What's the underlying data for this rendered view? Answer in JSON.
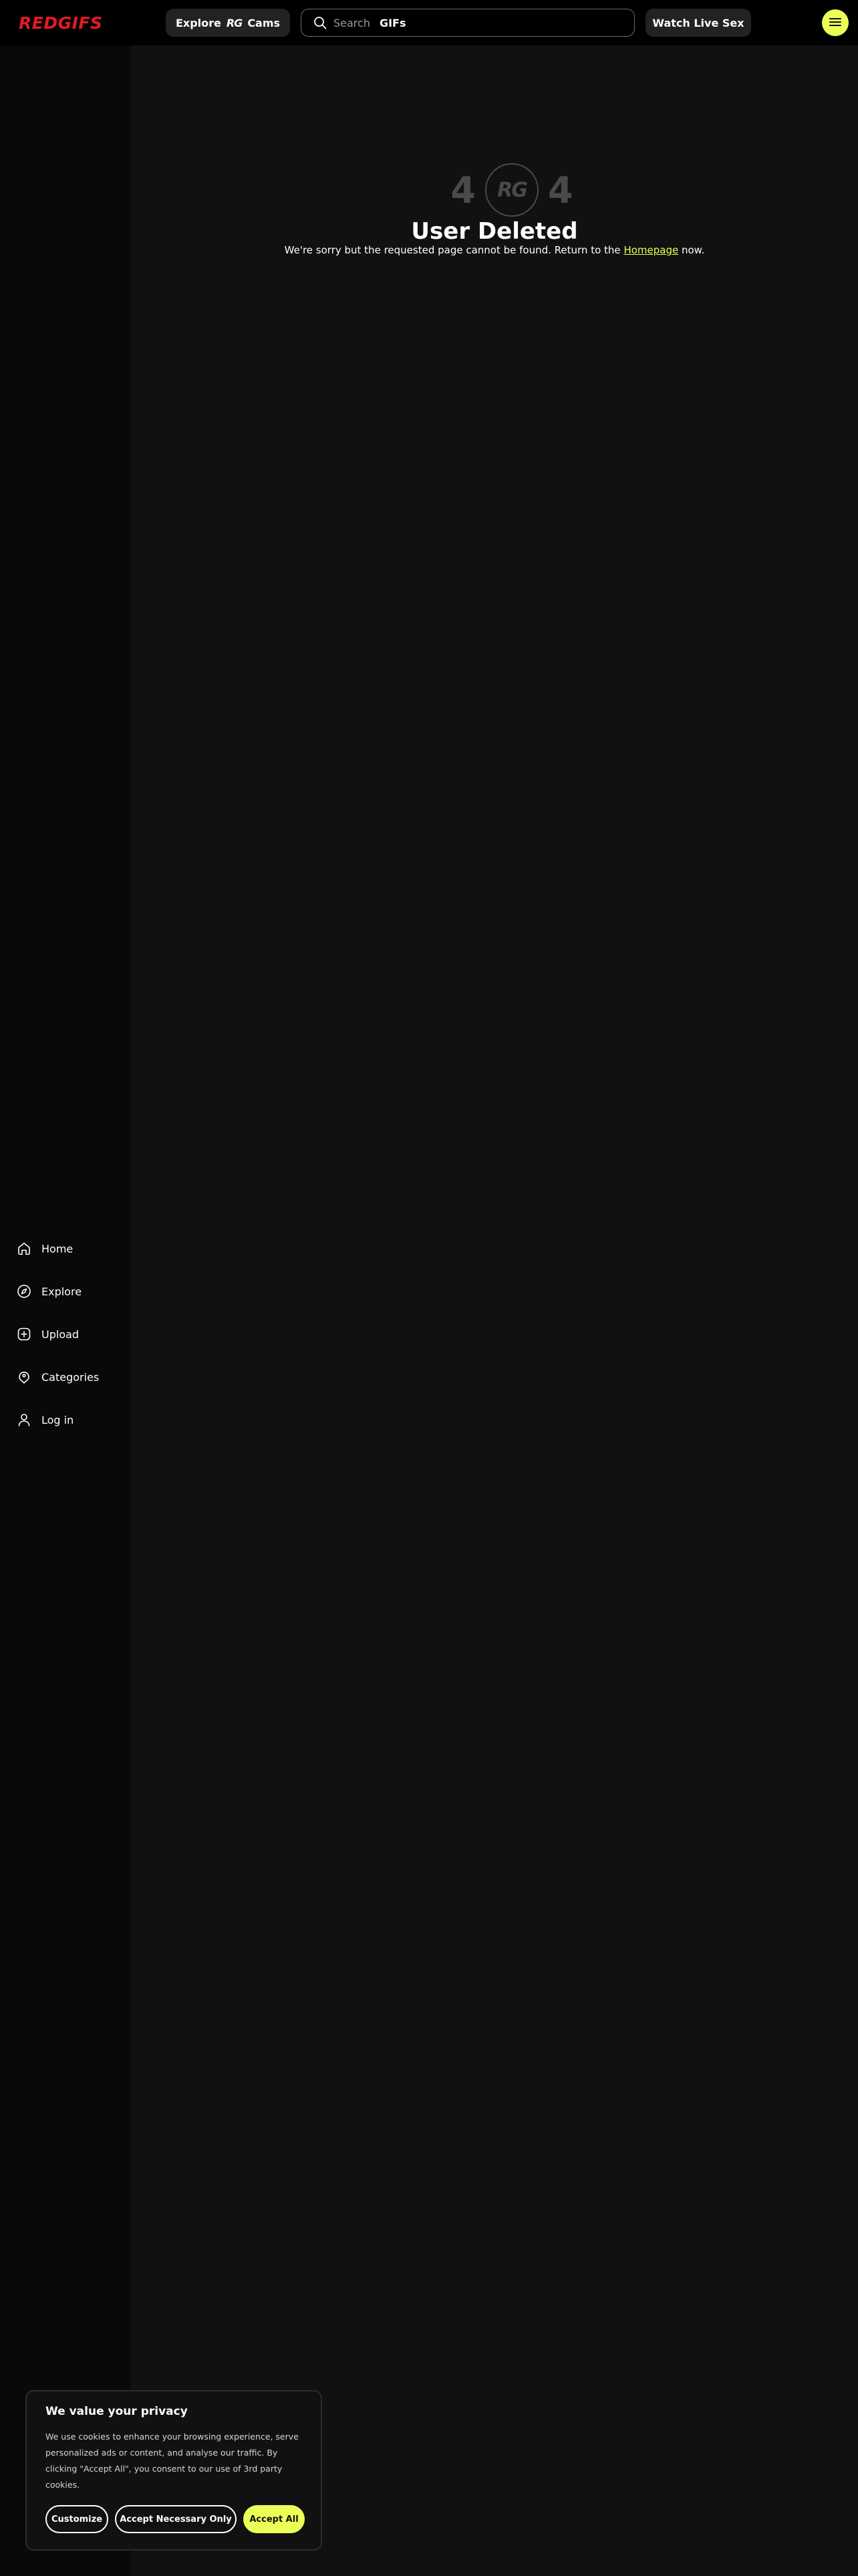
{
  "header": {
    "logo": "REDGIFS",
    "explore_button": {
      "prefix": "Explore",
      "brand": "RG",
      "suffix": "Cams"
    },
    "search": {
      "placeholder": "Search",
      "scope": "GIFs"
    },
    "live_button": "Watch Live Sex",
    "menu_icon": "hamburger-icon"
  },
  "sidebar": {
    "items": [
      {
        "label": "Home",
        "icon": "home-icon"
      },
      {
        "label": "Explore",
        "icon": "compass-icon"
      },
      {
        "label": "Upload",
        "icon": "upload-plus-icon"
      },
      {
        "label": "Categories",
        "icon": "tag-icon"
      },
      {
        "label": "Log in",
        "icon": "user-icon"
      }
    ]
  },
  "error": {
    "digit_left": "4",
    "logo": "RG",
    "digit_right": "4",
    "title": "User Deleted",
    "message_before": "We're sorry but the requested page cannot be found. Return to the",
    "link": "Homepage",
    "message_after": "now."
  },
  "cookie_banner": {
    "title": "We value your privacy",
    "text": "We use cookies to enhance your browsing experience, serve personalized ads or content, and analyse our traffic. By clicking \"Accept All\", you consent to our use of 3rd party cookies.",
    "buttons": {
      "customize": "Customize",
      "necessary": "Accept Necessary Only",
      "accept": "Accept All"
    }
  },
  "colors": {
    "brand_red": "#e01b24",
    "accent_yellow": "#ebff57",
    "background": "#111111",
    "header": "#000000",
    "sidebar": "#090909",
    "muted_404": "#4a4a4a"
  }
}
